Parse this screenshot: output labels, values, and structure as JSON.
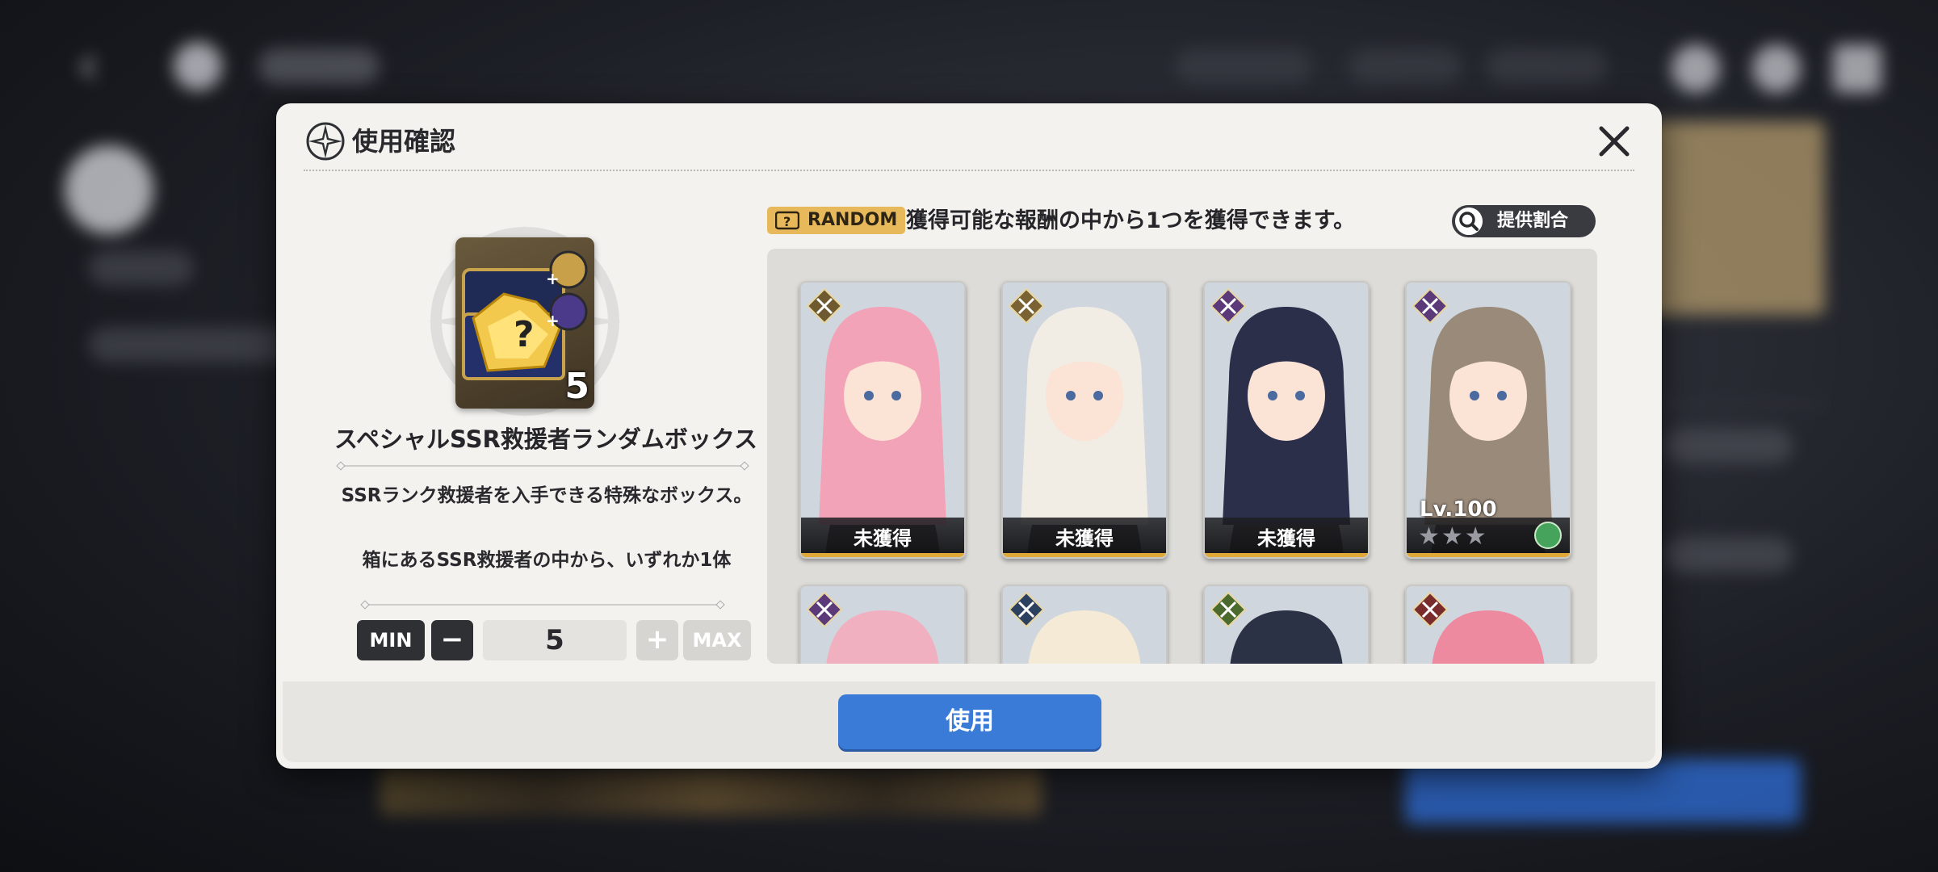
{
  "dialog": {
    "title": "使用確認",
    "close_icon": "close-icon"
  },
  "item": {
    "name": "スペシャルSSR救援者ランダムボックス",
    "count": "5",
    "description": [
      "SSRランク救援者を入手できる特殊なボックス。",
      "箱にあるSSR救援者の中から、いずれか1体"
    ]
  },
  "quantity": {
    "min_label": "MIN",
    "minus_label": "−",
    "value": "5",
    "plus_label": "+",
    "max_label": "MAX"
  },
  "rewards": {
    "random_label": "RANDOM",
    "info_text": "獲得可能な報酬の中から1つを獲得できます。",
    "rates_button": "提供割合",
    "cards": [
      {
        "status": "未獲得",
        "hair": "#f2a3b8",
        "class_color": "#6e5a2e"
      },
      {
        "status": "未獲得",
        "hair": "#f1ece4",
        "class_color": "#7a6233"
      },
      {
        "status": "未獲得",
        "hair": "#2b2f4a",
        "class_color": "#5c3a7a"
      },
      {
        "level": "Lv.100",
        "stars": "★★★",
        "hair": "#9a8a7a",
        "class_color": "#5c3a7a"
      },
      {
        "hair": "#f0b0c0",
        "class_color": "#5c3a7a"
      },
      {
        "hair": "#f4ead6",
        "class_color": "#2c4060"
      },
      {
        "hair": "#2c3246",
        "class_color": "#4a6a2e"
      },
      {
        "hair": "#ee8aa0",
        "class_color": "#7a2c2c"
      }
    ]
  },
  "footer": {
    "use_button": "使用"
  },
  "colors": {
    "accent_blue": "#3b7bd8",
    "random_tag": "#e7b95a",
    "card_border_gold": "#e0a93a"
  }
}
